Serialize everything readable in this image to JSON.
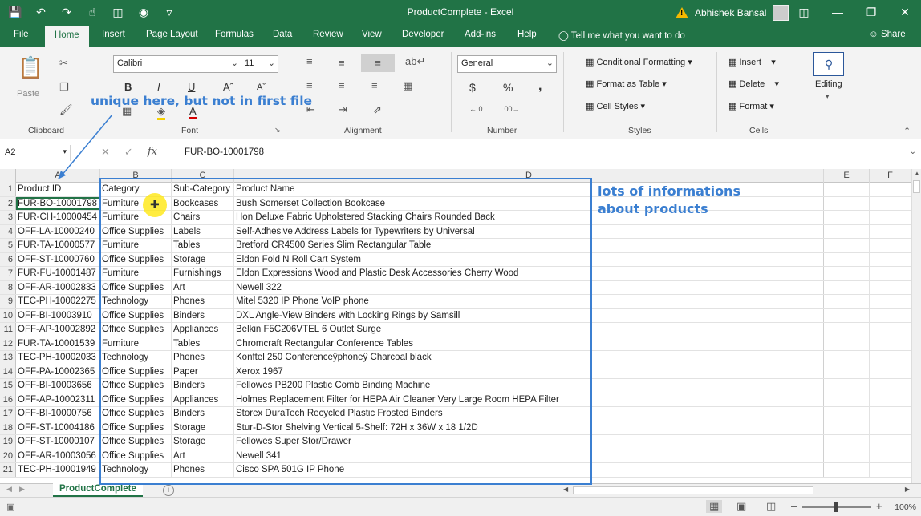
{
  "window": {
    "title": "ProductComplete  -  Excel",
    "user": "Abhishek Bansal"
  },
  "tabs": [
    "File",
    "Home",
    "Insert",
    "Page Layout",
    "Formulas",
    "Data",
    "Review",
    "View",
    "Developer",
    "Add-ins",
    "Help"
  ],
  "tell_me": "Tell me what you want to do",
  "share": "Share",
  "ribbon": {
    "clipboard": {
      "label": "Clipboard",
      "paste": "Paste"
    },
    "font": {
      "label": "Font",
      "name": "Calibri",
      "size": "11"
    },
    "alignment": {
      "label": "Alignment"
    },
    "number": {
      "label": "Number",
      "format": "General",
      "currency": "$",
      "percent": "%",
      "comma": ","
    },
    "styles": {
      "label": "Styles",
      "conditional": "Conditional Formatting",
      "format_table": "Format as Table",
      "cell_styles": "Cell Styles"
    },
    "cells": {
      "label": "Cells",
      "insert": "Insert",
      "delete": "Delete",
      "format": "Format"
    },
    "editing": {
      "label": "Editing"
    }
  },
  "formula_bar": {
    "name_box": "A2",
    "formula": "FUR-BO-10001798"
  },
  "columns": [
    "A",
    "B",
    "C",
    "D",
    "E",
    "F"
  ],
  "rows": [
    {
      "n": "1",
      "a": "Product ID",
      "b": "Category",
      "c": "Sub-Category",
      "d": "Product Name"
    },
    {
      "n": "2",
      "a": "FUR-BO-10001798",
      "b": "Furniture",
      "c": "Bookcases",
      "d": "Bush Somerset Collection Bookcase"
    },
    {
      "n": "3",
      "a": "FUR-CH-10000454",
      "b": "Furniture",
      "c": "Chairs",
      "d": "Hon Deluxe Fabric Upholstered Stacking Chairs  Rounded Back"
    },
    {
      "n": "4",
      "a": "OFF-LA-10000240",
      "b": "Office Supplies",
      "c": "Labels",
      "d": "Self-Adhesive Address Labels for Typewriters by Universal"
    },
    {
      "n": "5",
      "a": "FUR-TA-10000577",
      "b": "Furniture",
      "c": "Tables",
      "d": "Bretford CR4500 Series Slim Rectangular Table"
    },
    {
      "n": "6",
      "a": "OFF-ST-10000760",
      "b": "Office Supplies",
      "c": "Storage",
      "d": "Eldon Fold N Roll Cart System"
    },
    {
      "n": "7",
      "a": "FUR-FU-10001487",
      "b": "Furniture",
      "c": "Furnishings",
      "d": "Eldon Expressions Wood and Plastic Desk Accessories  Cherry Wood"
    },
    {
      "n": "8",
      "a": "OFF-AR-10002833",
      "b": "Office Supplies",
      "c": "Art",
      "d": "Newell 322"
    },
    {
      "n": "9",
      "a": "TEC-PH-10002275",
      "b": "Technology",
      "c": "Phones",
      "d": "Mitel 5320 IP Phone VoIP phone"
    },
    {
      "n": "10",
      "a": "OFF-BI-10003910",
      "b": "Office Supplies",
      "c": "Binders",
      "d": "DXL Angle-View Binders with Locking Rings by Samsill"
    },
    {
      "n": "11",
      "a": "OFF-AP-10002892",
      "b": "Office Supplies",
      "c": "Appliances",
      "d": "Belkin F5C206VTEL 6 Outlet Surge"
    },
    {
      "n": "12",
      "a": "FUR-TA-10001539",
      "b": "Furniture",
      "c": "Tables",
      "d": "Chromcraft Rectangular Conference Tables"
    },
    {
      "n": "13",
      "a": "TEC-PH-10002033",
      "b": "Technology",
      "c": "Phones",
      "d": "Konftel 250 Conferenceÿphoneÿ Charcoal black"
    },
    {
      "n": "14",
      "a": "OFF-PA-10002365",
      "b": "Office Supplies",
      "c": "Paper",
      "d": "Xerox 1967"
    },
    {
      "n": "15",
      "a": "OFF-BI-10003656",
      "b": "Office Supplies",
      "c": "Binders",
      "d": "Fellowes PB200 Plastic Comb Binding Machine"
    },
    {
      "n": "16",
      "a": "OFF-AP-10002311",
      "b": "Office Supplies",
      "c": "Appliances",
      "d": "Holmes Replacement Filter for HEPA Air Cleaner  Very Large Room  HEPA Filter"
    },
    {
      "n": "17",
      "a": "OFF-BI-10000756",
      "b": "Office Supplies",
      "c": "Binders",
      "d": "Storex DuraTech Recycled Plastic Frosted Binders"
    },
    {
      "n": "18",
      "a": "OFF-ST-10004186",
      "b": "Office Supplies",
      "c": "Storage",
      "d": "Stur-D-Stor Shelving  Vertical 5-Shelf: 72H x 36W x 18 1/2D"
    },
    {
      "n": "19",
      "a": "OFF-ST-10000107",
      "b": "Office Supplies",
      "c": "Storage",
      "d": "Fellowes Super Stor/Drawer"
    },
    {
      "n": "20",
      "a": "OFF-AR-10003056",
      "b": "Office Supplies",
      "c": "Art",
      "d": "Newell 341"
    },
    {
      "n": "21",
      "a": "TEC-PH-10001949",
      "b": "Technology",
      "c": "Phones",
      "d": "Cisco SPA 501G IP Phone"
    }
  ],
  "sheet_tab": "ProductComplete",
  "add_sheet": "+",
  "zoom": "100%",
  "annotations": {
    "unique": "unique here, but not in first file",
    "info_line1": "lots of informations",
    "info_line2": "about products"
  },
  "colors": {
    "excel_green": "#217346",
    "annotation_blue": "#3b7fd1"
  }
}
